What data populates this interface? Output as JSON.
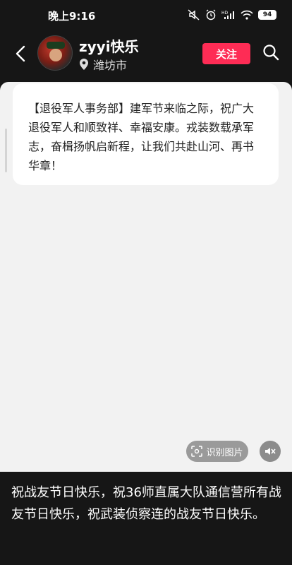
{
  "status_bar": {
    "time": "晚上9:16",
    "battery": "94",
    "icons": [
      "mute-icon",
      "alarm-icon",
      "hd-signal-icon",
      "wifi-icon",
      "battery-icon"
    ]
  },
  "header": {
    "back_icon": "chevron-left-icon",
    "username": "zyyi快乐",
    "location": "潍坊市",
    "location_icon": "location-pin-icon",
    "follow_label": "关注",
    "follow_color": "#fe2c55",
    "search_icon": "search-icon"
  },
  "post": {
    "text": "【退役军人事务部】建军节来临之际，祝广大退役军人和顺致祥、幸福安康。戎装数载承军志，奋楫扬帆启新程，让我们共赴山河、再书华章！",
    "ocr_label": "识别图片",
    "ocr_icon": "scan-icon",
    "mute_icon": "speaker-muted-icon"
  },
  "caption": {
    "text": "祝战友节日快乐，祝36师直属大队通信营所有战友节日快乐，祝武装侦察连的战友节日快乐。"
  }
}
